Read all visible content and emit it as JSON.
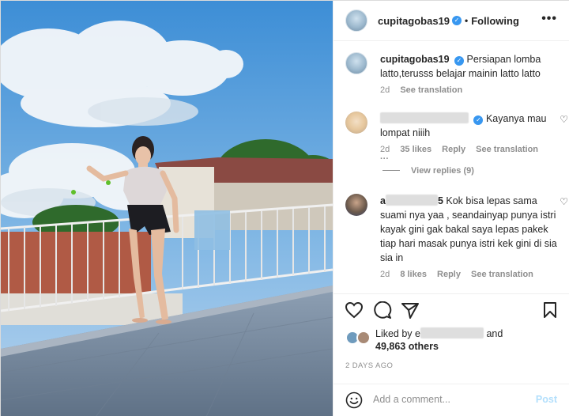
{
  "post": {
    "username": "cupitagobas19",
    "follow_status": "Following",
    "more_icon": "•••"
  },
  "caption": {
    "username": "cupitagobas19",
    "text": "Persiapan lomba latto,terusss belajar mainin latto latto",
    "age": "2d",
    "see_translation": "See translation"
  },
  "comments": [
    {
      "text_suffix": "Kayanya mau lompat niiih",
      "age": "2d",
      "likes": "35 likes",
      "reply": "Reply",
      "see_translation": "See translation",
      "more": "···",
      "view_replies": "View replies (9)"
    },
    {
      "name_prefix": "a",
      "name_suffix": "5",
      "text": "Kok bisa lepas sama suami nya yaa , seandainyap punya istri kayak gini gak bakal saya lepas pakek tiap hari masak punya istri kek gini di sia sia in",
      "age": "2d",
      "likes": "8 likes",
      "reply": "Reply",
      "see_translation": "See translation"
    }
  ],
  "likes": {
    "liked_by": "Liked by e",
    "and": "and",
    "others": "49,863 others"
  },
  "date": "2 DAYS AGO",
  "add_comment": {
    "placeholder": "Add a comment...",
    "post_label": "Post"
  },
  "icons": [
    "heart-icon",
    "comment-icon",
    "share-icon",
    "bookmark-icon",
    "smiley-icon",
    "verified-badge-icon",
    "more-options-icon"
  ]
}
